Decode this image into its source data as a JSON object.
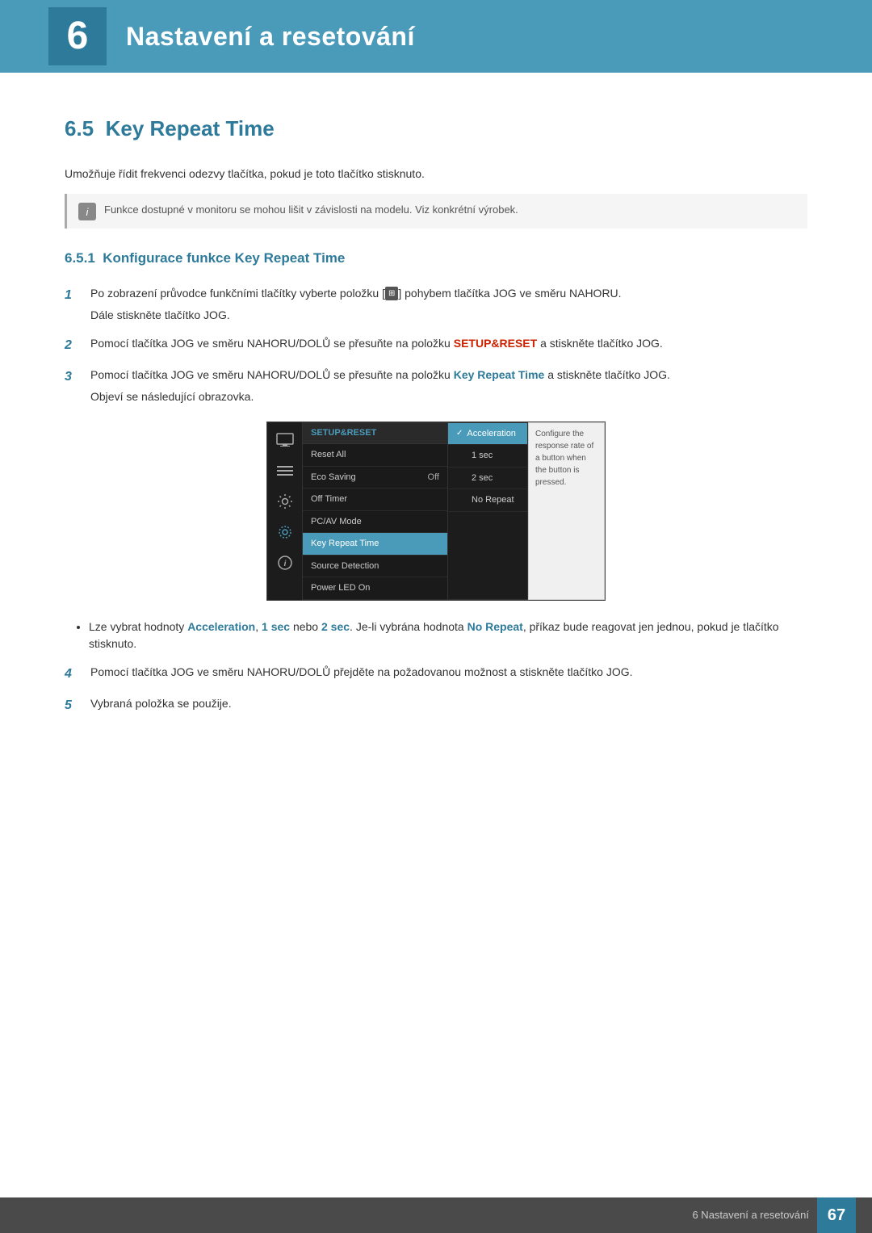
{
  "chapter": {
    "number": "6",
    "title": "Nastavení a resetování"
  },
  "section": {
    "number": "6.5",
    "title": "Key Repeat Time",
    "intro": "Umožňuje řídit frekvenci odezvy tlačítka, pokud je toto tlačítko stisknuto."
  },
  "note": {
    "text": "Funkce dostupné v monitoru se mohou lišit v závislosti na modelu. Viz konkrétní výrobek."
  },
  "subsection": {
    "number": "6.5.1",
    "title": "Konfigurace funkce Key Repeat Time"
  },
  "steps": [
    {
      "number": "1",
      "text": "Po zobrazení průvodce funkčními tlačítky vyberte položku [",
      "icon": "⊞",
      "text2": "] pohybem tlačítka JOG ve směru NAHORU.",
      "sub": "Dále stiskněte tlačítko JOG."
    },
    {
      "number": "2",
      "text": "Pomocí tlačítka JOG ve směru NAHORU/DOLŮ se přesuňte na položku ",
      "highlight": "SETUP&RESET",
      "highlight_class": "red",
      "text2": " a stiskněte tlačítko JOG."
    },
    {
      "number": "3",
      "text": "Pomocí tlačítka JOG ve směru NAHORU/DOLŮ se přesuňte na položku ",
      "highlight": "Key Repeat Time",
      "highlight_class": "teal",
      "text2": " a stiskněte tlačítko JOG.",
      "sub": "Objeví se následující obrazovka."
    },
    {
      "number": "4",
      "text": "Pomocí tlačítka JOG ve směru NAHORU/DOLŮ přejděte na požadovanou možnost a stiskněte tlačítko JOG."
    },
    {
      "number": "5",
      "text": "Vybraná položka se použije."
    }
  ],
  "screen": {
    "header": "SETUP&RESET",
    "menu_items": [
      {
        "label": "Reset All",
        "value": ""
      },
      {
        "label": "Eco Saving",
        "value": "Off"
      },
      {
        "label": "Off Timer",
        "value": ""
      },
      {
        "label": "PC/AV Mode",
        "value": ""
      },
      {
        "label": "Key Repeat Time",
        "value": "",
        "active": true
      },
      {
        "label": "Source Detection",
        "value": ""
      },
      {
        "label": "Power LED On",
        "value": ""
      }
    ],
    "submenu_items": [
      {
        "label": "Acceleration",
        "active": true,
        "check": true
      },
      {
        "label": "1 sec",
        "active": false
      },
      {
        "label": "2 sec",
        "active": false
      },
      {
        "label": "No Repeat",
        "active": false
      }
    ],
    "tooltip": "Configure the response rate of a button when the button is pressed."
  },
  "bullet": {
    "text_before": "Lze vybrat hodnoty ",
    "accel": "Acceleration",
    "comma1": ", ",
    "one_sec": "1 sec",
    "or": " nebo ",
    "two_sec": "2 sec",
    "text_mid": ". Je-li vybrána hodnota ",
    "no_repeat": "No Repeat",
    "text_after": ", příkaz bude reagovat jen jednou, pokud je tlačítko stisknuto."
  },
  "footer": {
    "text": "6 Nastavení a resetování",
    "page": "67"
  }
}
